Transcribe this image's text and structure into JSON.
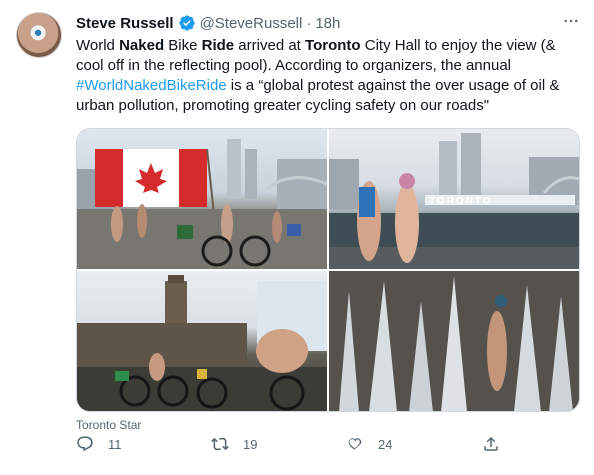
{
  "author": {
    "name": "Steve Russell",
    "handle": "@SteveRussell",
    "separator": "·",
    "time": "18h"
  },
  "tweet_text": {
    "p1": "World ",
    "b1": "Naked",
    "p2": " Bike ",
    "b2": "Ride",
    "p3": " arrived at ",
    "b3": "Toronto",
    "p4": " City Hall to enjoy the view (& cool off in the reflecting pool). According to organizers, the annual ",
    "hashtag": "#WorldNakedBikeRide",
    "p5": " is a “global protest against the over usage of oil & urban pollution, promoting greater cycling safety on our roads\""
  },
  "media": {
    "caption": "Toronto Star",
    "photo1_sign": "TORONTO"
  },
  "actions": {
    "replies": "11",
    "retweets": "19",
    "likes": "24"
  },
  "colors": {
    "link": "#1d9bf0",
    "secondary_text": "#536471",
    "verified": "#1d9bf0"
  },
  "icons": [
    "verified-badge-icon",
    "more-icon",
    "reply-icon",
    "retweet-icon",
    "like-icon",
    "share-icon"
  ]
}
